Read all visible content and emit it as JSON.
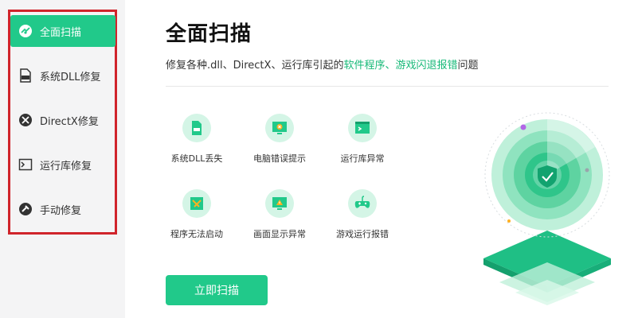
{
  "sidebar": {
    "items": [
      {
        "label": "全面扫描",
        "icon": "radar-scan-icon",
        "active": true
      },
      {
        "label": "系统DLL修复",
        "icon": "dll-file-icon",
        "active": false
      },
      {
        "label": "DirectX修复",
        "icon": "directx-icon",
        "active": false
      },
      {
        "label": "运行库修复",
        "icon": "terminal-icon",
        "active": false
      },
      {
        "label": "手动修复",
        "icon": "wrench-hand-icon",
        "active": false
      }
    ]
  },
  "main": {
    "title": "全面扫描",
    "subtitle_prefix": "修复各种.dll、DirectX、运行库引起的",
    "subtitle_highlight": "软件程序、游戏闪退报错",
    "subtitle_suffix": "问题",
    "features": [
      {
        "label": "系统DLL丢失",
        "icon": "dll-file-icon"
      },
      {
        "label": "电脑错误提示",
        "icon": "monitor-error-icon"
      },
      {
        "label": "运行库异常",
        "icon": "runtime-window-icon"
      },
      {
        "label": "程序无法启动",
        "icon": "broken-program-icon"
      },
      {
        "label": "画面显示异常",
        "icon": "display-warning-icon"
      },
      {
        "label": "游戏运行报错",
        "icon": "gamepad-icon"
      }
    ],
    "scan_button": "立即扫描"
  },
  "colors": {
    "accent": "#21c98a",
    "highlight_text": "#17b978",
    "sidebar_bg": "#f4f4f5",
    "annotation_frame": "#d0242b"
  }
}
